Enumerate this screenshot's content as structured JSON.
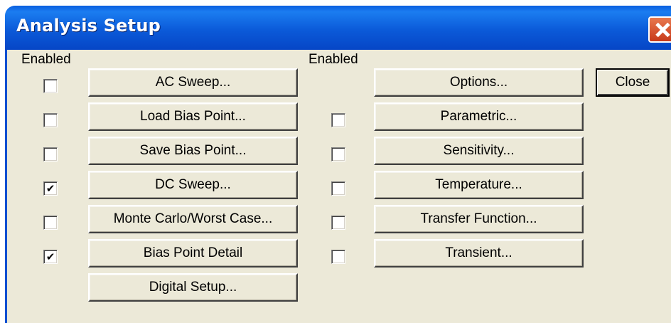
{
  "dialog": {
    "title": "Analysis Setup",
    "left_enabled_header": "Enabled",
    "right_enabled_header": "Enabled",
    "close_label": "Close"
  },
  "left_column": [
    {
      "label": "AC Sweep...",
      "checked": false
    },
    {
      "label": "Load Bias Point...",
      "checked": false
    },
    {
      "label": "Save Bias Point...",
      "checked": false
    },
    {
      "label": "DC Sweep...",
      "checked": true
    },
    {
      "label": "Monte Carlo/Worst Case...",
      "checked": false
    },
    {
      "label": "Bias Point Detail",
      "checked": true
    },
    {
      "label": "Digital Setup..."
    }
  ],
  "right_column": [
    {
      "label": "Options..."
    },
    {
      "label": "Parametric...",
      "checked": false
    },
    {
      "label": "Sensitivity...",
      "checked": false
    },
    {
      "label": "Temperature...",
      "checked": false
    },
    {
      "label": "Transfer Function...",
      "checked": false
    },
    {
      "label": "Transient...",
      "checked": false
    }
  ],
  "icons": {
    "checkmark": "check-icon",
    "close": "close-icon"
  }
}
